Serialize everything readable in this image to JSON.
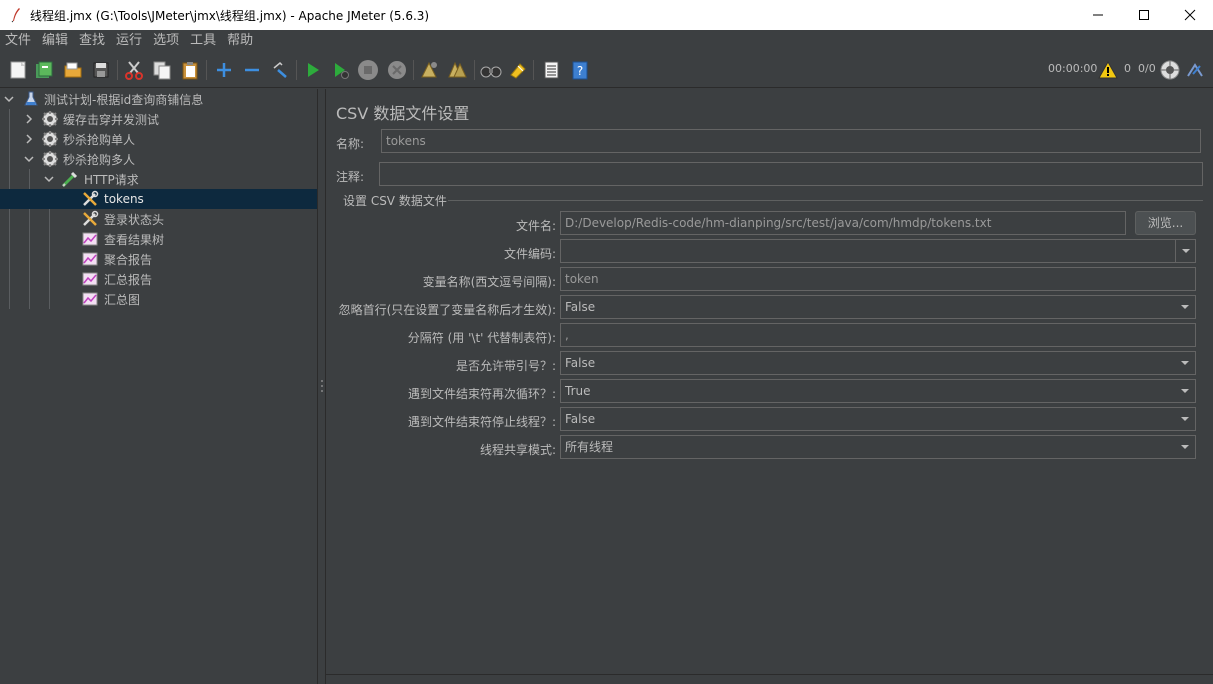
{
  "window": {
    "title": "线程组.jmx (G:\\Tools\\JMeter\\jmx\\线程组.jmx) - Apache JMeter (5.6.3)"
  },
  "menu": [
    "文件",
    "编辑",
    "查找",
    "运行",
    "选项",
    "工具",
    "帮助"
  ],
  "toolbar": {
    "timer": "00:00:00",
    "warnings": "0",
    "threads": "0/0"
  },
  "tree": {
    "items": [
      {
        "label": "测试计划-根据id查询商铺信息"
      },
      {
        "label": "缓存击穿并发测试"
      },
      {
        "label": "秒杀抢购单人"
      },
      {
        "label": "秒杀抢购多人"
      },
      {
        "label": "HTTP请求"
      },
      {
        "label": "tokens"
      },
      {
        "label": "登录状态头"
      },
      {
        "label": "查看结果树"
      },
      {
        "label": "聚合报告"
      },
      {
        "label": "汇总报告"
      },
      {
        "label": "汇总图"
      }
    ]
  },
  "panel": {
    "title": "CSV 数据文件设置",
    "name_label": "名称:",
    "name_value": "tokens",
    "comment_label": "注释:",
    "comment_value": "",
    "group_title": "设置 CSV 数据文件",
    "filename_label": "文件名:",
    "filename_value": "D:/Develop/Redis-code/hm-dianping/src/test/java/com/hmdp/tokens.txt",
    "browse_label": "浏览...",
    "encoding_label": "文件编码:",
    "encoding_value": "",
    "varnames_label": "变量名称(西文逗号间隔):",
    "varnames_value": "token",
    "ignore_first_label": "忽略首行(只在设置了变量名称后才生效):",
    "ignore_first_value": "False",
    "delimiter_label": "分隔符 (用 '\\t' 代替制表符):",
    "delimiter_value": ",",
    "quoted_label": "是否允许带引号？:",
    "quoted_value": "False",
    "recycle_label": "遇到文件结束符再次循环？:",
    "recycle_value": "True",
    "stop_label": "遇到文件结束符停止线程？:",
    "stop_value": "False",
    "share_label": "线程共享模式:",
    "share_value": "所有线程"
  }
}
